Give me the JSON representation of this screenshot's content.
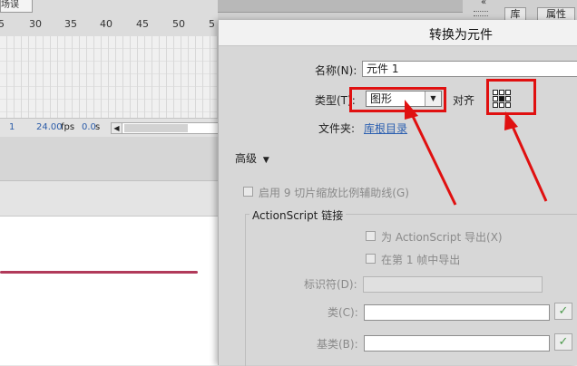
{
  "timeline": {
    "tab_label": "场误",
    "ruler_numbers": [
      "5",
      "30",
      "35",
      "40",
      "45",
      "50",
      "5"
    ],
    "current_frame": "1",
    "fps_value": "24.00",
    "fps_unit": "fps",
    "time_value": "0.0",
    "time_unit": "s"
  },
  "panel_tabs": {
    "library": "库",
    "properties": "属性"
  },
  "dialog": {
    "title": "转换为元件",
    "name_label": "名称(N):",
    "name_value": "元件 1",
    "type_label": "类型(T):",
    "type_value": "图形",
    "align_label": "对齐",
    "folder_label": "文件夹:",
    "folder_value": "库根目录",
    "advanced_label": "高级",
    "enable_9slice_label": "启用 9 切片缩放比例辅助线(G)",
    "as_group_label": "ActionScript 链接",
    "export_as_label": "为 ActionScript 导出(X)",
    "export_frame1_label": "在第 1 帧中导出",
    "identifier_label": "标识符(D):",
    "class_label": "类(C):",
    "base_class_label": "基类(B):",
    "class_value": "",
    "base_class_value": "",
    "identifier_value": ""
  },
  "colors": {
    "highlight_red": "#e01010",
    "link_blue": "#2b5fb0",
    "stage_line": "#b13a5a"
  }
}
